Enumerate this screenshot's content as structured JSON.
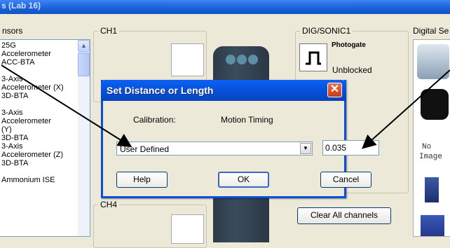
{
  "window": {
    "title": "s (Lab 16)"
  },
  "sensors": {
    "heading": "nsors",
    "items": [
      "25G",
      "Accelerometer",
      "ACC-BTA",
      "3-Axis",
      "Accelerometer (X)",
      "3D-BTA",
      "3-Axis",
      "Accelerometer",
      "(Y)",
      "3D-BTA",
      "3-Axis",
      "Accelerometer (Z)",
      "3D-BTA",
      "Ammonium ISE"
    ]
  },
  "channels": {
    "ch1_label": "CH1",
    "ch4_label": "CH4",
    "dig_label": "DIG/SONIC1",
    "photogate_label": "Photogate",
    "photogate_state": "Unblocked",
    "clear_button": "Clear All channels"
  },
  "digital_sensors": {
    "heading": "Digital Se",
    "no_image_line1": "No",
    "no_image_line2": "Image"
  },
  "dialog": {
    "title": "Set Distance or Length",
    "calibration_label": "Calibration:",
    "calibration_value": "Motion Timing",
    "dropdown_value": "User Defined",
    "length_value": "0.035",
    "help_button": "Help",
    "ok_button": "OK",
    "cancel_button": "Cancel"
  },
  "colors": {
    "title_bar": "#1a5fd6",
    "dialog_border": "#0a4fd8",
    "close_button": "#d9522c",
    "window_bg": "#ece9d8"
  },
  "icons": {
    "close": "close-icon",
    "dropdown": "chevron-down-icon",
    "scroll_up": "chevron-up-icon",
    "photogate": "photogate-icon"
  }
}
